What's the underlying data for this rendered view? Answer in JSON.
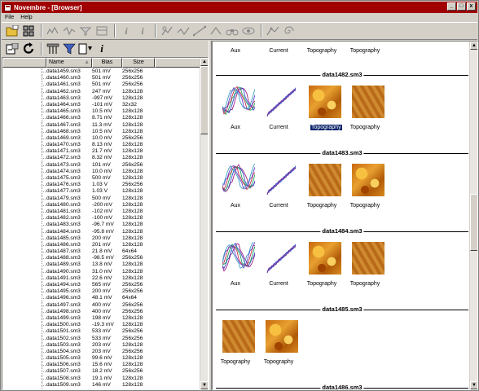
{
  "window": {
    "title": "Novembre - [Browser]",
    "buttons": [
      "_",
      "□",
      "x"
    ]
  },
  "menu": {
    "items": [
      "File",
      "Help"
    ]
  },
  "list": {
    "columns": {
      "name": "Name",
      "bias": "Bias",
      "size": "Size"
    },
    "rows": [
      [
        "data1459.sm3",
        "501 mV",
        "256x256"
      ],
      [
        "data1460.sm3",
        "501 mV",
        "256x256"
      ],
      [
        "data1461.sm3",
        "501 mV",
        "256x256"
      ],
      [
        "data1462.sm3",
        "247 mV",
        "128x128"
      ],
      [
        "data1463.sm3",
        "-997 mV",
        "128x128"
      ],
      [
        "data1464.sm3",
        "-101 mV",
        "32x32"
      ],
      [
        "data1465.sm3",
        "10.5 mV",
        "128x128"
      ],
      [
        "data1466.sm3",
        "8.71 mV",
        "128x128"
      ],
      [
        "data1467.sm3",
        "11.3 mV",
        "128x128"
      ],
      [
        "data1468.sm3",
        "10.5 mV",
        "128x128"
      ],
      [
        "data1469.sm3",
        "10.0 mV",
        "256x256"
      ],
      [
        "data1470.sm3",
        "8.13 mV",
        "128x128"
      ],
      [
        "data1471.sm3",
        "21.7 mV",
        "128x128"
      ],
      [
        "data1472.sm3",
        "8.32 mV",
        "128x128"
      ],
      [
        "data1473.sm3",
        "101 mV",
        "256x256"
      ],
      [
        "data1474.sm3",
        "10.0 mV",
        "128x128"
      ],
      [
        "data1475.sm3",
        "500 mV",
        "128x128"
      ],
      [
        "data1476.sm3",
        "1.03 V",
        "256x256"
      ],
      [
        "data1477.sm3",
        "1.03 V",
        "128x128"
      ],
      [
        "data1479.sm3",
        "500 mV",
        "128x128"
      ],
      [
        "data1480.sm3",
        "-200 mV",
        "128x128"
      ],
      [
        "data1481.sm3",
        "-102 mV",
        "128x128"
      ],
      [
        "data1482.sm3",
        "-100 mV",
        "128x128"
      ],
      [
        "data1483.sm3",
        "-96.7 mV",
        "128x128"
      ],
      [
        "data1484.sm3",
        "-95.8 mV",
        "128x128"
      ],
      [
        "data1485.sm3",
        "200 mV",
        "128x128"
      ],
      [
        "data1486.sm3",
        "201 mV",
        "128x128"
      ],
      [
        "data1487.sm3",
        "21.8 mV",
        "64x64"
      ],
      [
        "data1488.sm3",
        "-98.5 mV",
        "256x256"
      ],
      [
        "data1489.sm3",
        "13.8 mV",
        "128x128"
      ],
      [
        "data1490.sm3",
        "31.0 mV",
        "128x128"
      ],
      [
        "data1491.sm3",
        "22.6 mV",
        "128x128"
      ],
      [
        "data1494.sm3",
        "565 mV",
        "256x256"
      ],
      [
        "data1495.sm3",
        "200 mV",
        "256x256"
      ],
      [
        "data1496.sm3",
        "48.1 mV",
        "64x64"
      ],
      [
        "data1497.sm3",
        "400 mV",
        "256x256"
      ],
      [
        "data1498.sm3",
        "400 mV",
        "256x256"
      ],
      [
        "data1499.sm3",
        "198 mV",
        "128x128"
      ],
      [
        "data1500.sm3",
        "-19.3 mV",
        "128x128"
      ],
      [
        "data1501.sm3",
        "533 mV",
        "256x256"
      ],
      [
        "data1502.sm3",
        "533 mV",
        "256x256"
      ],
      [
        "data1503.sm3",
        "203 mV",
        "128x128"
      ],
      [
        "data1504.sm3",
        "203 mV",
        "256x256"
      ],
      [
        "data1505.sm3",
        "99.6 mV",
        "128x128"
      ],
      [
        "data1506.sm3",
        "15.6 mV",
        "128x128"
      ],
      [
        "data1507.sm3",
        "18.2 mV",
        "256x256"
      ],
      [
        "data1508.sm3",
        "19.1 mV",
        "128x128"
      ],
      [
        "data1509.sm3",
        "146 mV",
        "128x128"
      ]
    ]
  },
  "browser": {
    "top_captions": [
      "Aux",
      "Current",
      "Topography",
      "Topography"
    ],
    "sections": [
      {
        "title": "data1482.sm3",
        "captions": [
          "Aux",
          "Current",
          "Topography",
          "Topography"
        ],
        "selected_index": 2
      },
      {
        "title": "data1483.sm3",
        "captions": [
          "Aux",
          "Current",
          "Topography",
          "Topography"
        ]
      },
      {
        "title": "data1484.sm3",
        "captions": [
          "Aux",
          "Current",
          "Topography",
          "Topography"
        ]
      },
      {
        "title": "data1485.sm3",
        "captions": [
          "Topography",
          "Topography"
        ]
      },
      {
        "title": "data1486.sm3",
        "captions": []
      }
    ]
  }
}
